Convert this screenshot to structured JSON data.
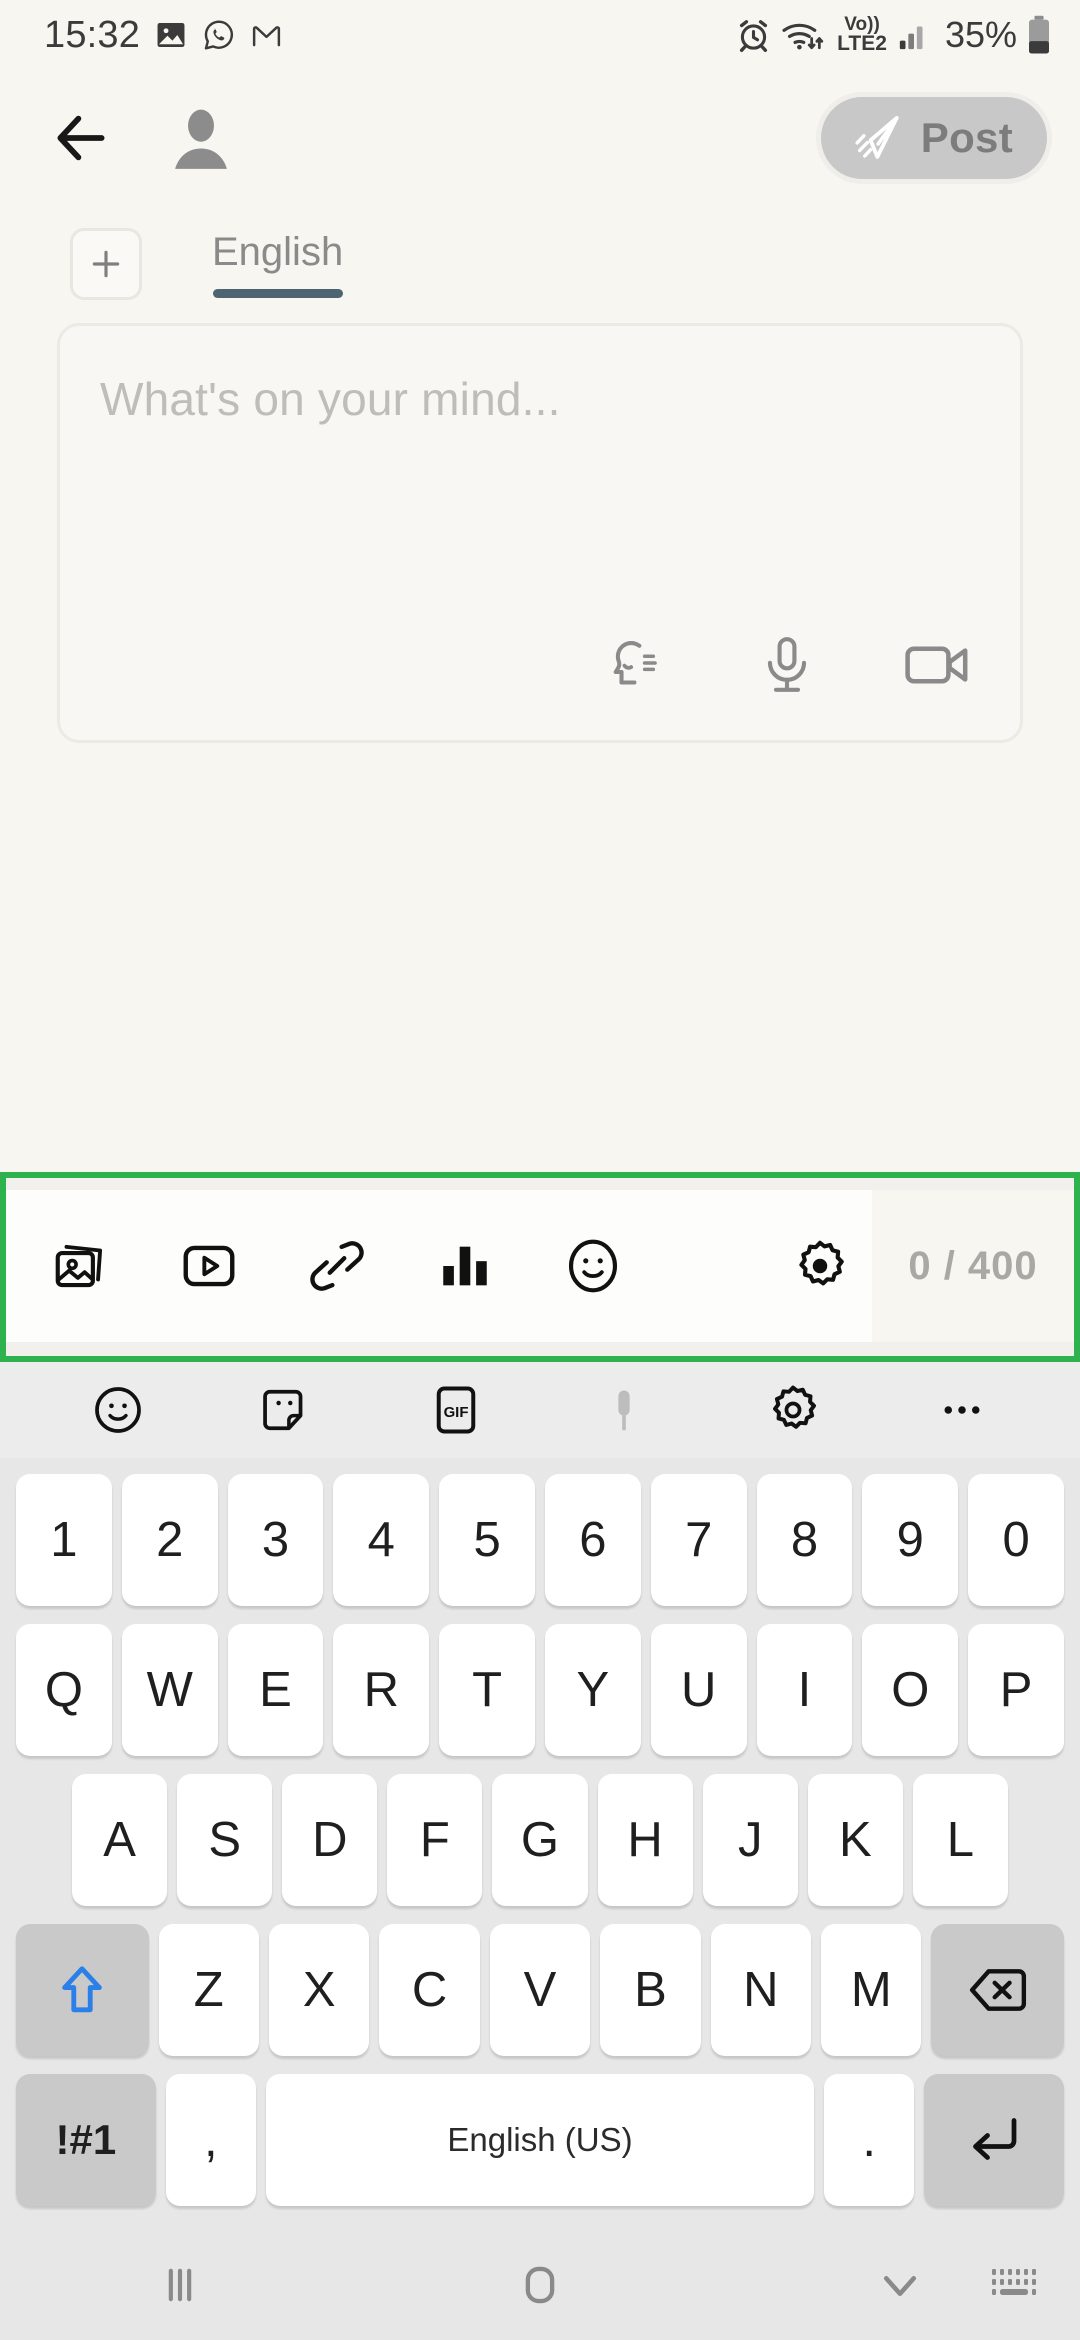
{
  "status_bar": {
    "time": "15:32",
    "left_icons": [
      "gallery-icon",
      "whatsapp-icon",
      "gmail-icon"
    ],
    "alarm_icon": "alarm-icon",
    "wifi_icon": "wifi-icon",
    "volte_top": "Vo))",
    "volte_bottom": "LTE2",
    "signal_icon": "signal-bars-icon",
    "battery_percent": "35%",
    "battery_icon": "battery-icon"
  },
  "app_bar": {
    "back_icon": "back-arrow-icon",
    "avatar_icon": "avatar-icon",
    "post_label": "Post",
    "post_icon": "paper-plane-icon",
    "post_enabled": false,
    "post_bg_color": "#c8c8c8",
    "post_text_color": "#7c7c7c"
  },
  "language_row": {
    "add_icon": "plus-icon",
    "tabs": [
      {
        "label": "English",
        "active": true
      }
    ],
    "underline_color": "#4d6471"
  },
  "composer": {
    "placeholder": "What's on your mind...",
    "value": "",
    "tools": [
      {
        "name": "text-to-speech-icon"
      },
      {
        "name": "microphone-icon"
      },
      {
        "name": "video-camera-icon"
      }
    ]
  },
  "action_bar": {
    "highlight_color": "#2eb24d",
    "highlighted": true,
    "icons": [
      {
        "name": "image-gallery-icon"
      },
      {
        "name": "video-play-icon"
      },
      {
        "name": "link-icon"
      },
      {
        "name": "poll-chart-icon"
      },
      {
        "name": "emoji-smiley-icon"
      }
    ],
    "settings_icon": "gear-icon",
    "char_counter": "0 / 400",
    "char_current": 0,
    "char_limit": 400
  },
  "keyboard": {
    "toolbar": [
      {
        "name": "emoji-icon",
        "enabled": true
      },
      {
        "name": "sticker-icon",
        "enabled": true
      },
      {
        "name": "gif-icon",
        "label": "GIF",
        "enabled": true
      },
      {
        "name": "microphone-icon",
        "enabled": false
      },
      {
        "name": "keyboard-settings-icon",
        "enabled": true
      },
      {
        "name": "more-options-icon",
        "enabled": true
      }
    ],
    "rows": {
      "numbers": [
        "1",
        "2",
        "3",
        "4",
        "5",
        "6",
        "7",
        "8",
        "9",
        "0"
      ],
      "top": [
        "Q",
        "W",
        "E",
        "R",
        "T",
        "Y",
        "U",
        "I",
        "O",
        "P"
      ],
      "home": [
        "A",
        "S",
        "D",
        "F",
        "G",
        "H",
        "J",
        "K",
        "L"
      ],
      "bottom": [
        "Z",
        "X",
        "C",
        "V",
        "B",
        "N",
        "M"
      ]
    },
    "shift_icon": "shift-arrow-icon",
    "shift_color": "#2a7fe8",
    "backspace_icon": "backspace-icon",
    "symbols_label": "!#1",
    "comma_label": ",",
    "space_label": "English (US)",
    "period_label": ".",
    "enter_icon": "enter-return-icon"
  },
  "nav_bar": {
    "recents_icon": "recents-icon",
    "home_icon": "home-icon",
    "dismiss_keyboard_icon": "chevron-down-icon",
    "keyboard_switch_icon": "keyboard-switch-icon"
  }
}
